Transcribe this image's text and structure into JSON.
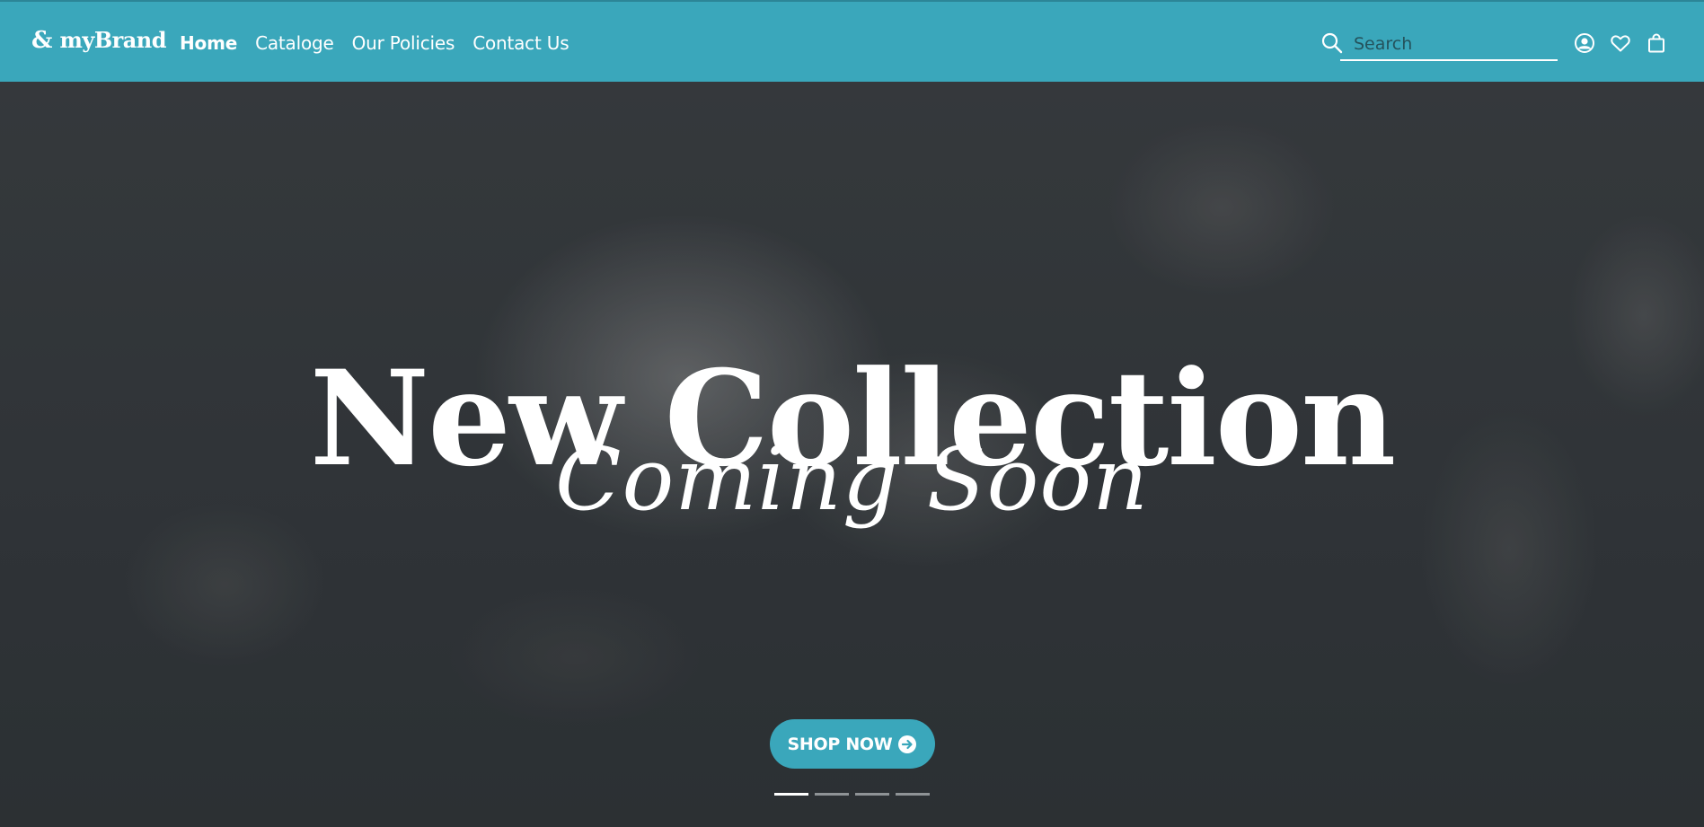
{
  "brand": {
    "mark": "&",
    "name": "myBrand"
  },
  "nav": {
    "links": [
      {
        "label": "Home",
        "active": true
      },
      {
        "label": "Cataloge",
        "active": false
      },
      {
        "label": "Our Policies",
        "active": false
      },
      {
        "label": "Contact Us",
        "active": false
      }
    ]
  },
  "search": {
    "placeholder": "Search",
    "icon": "search-icon"
  },
  "header_icons": [
    "account-icon",
    "wishlist-heart-icon",
    "shopping-bag-icon"
  ],
  "hero": {
    "title": "New Collection",
    "subtitle": "Coming Soon",
    "cta_label": "SHOP NOW",
    "cta_icon": "arrow-right-circle-icon",
    "slides_total": 4,
    "active_slide": 1
  },
  "colors": {
    "accent": "#3aa7bb",
    "hero_bg": "#33373a",
    "text_light": "#ffffff"
  }
}
